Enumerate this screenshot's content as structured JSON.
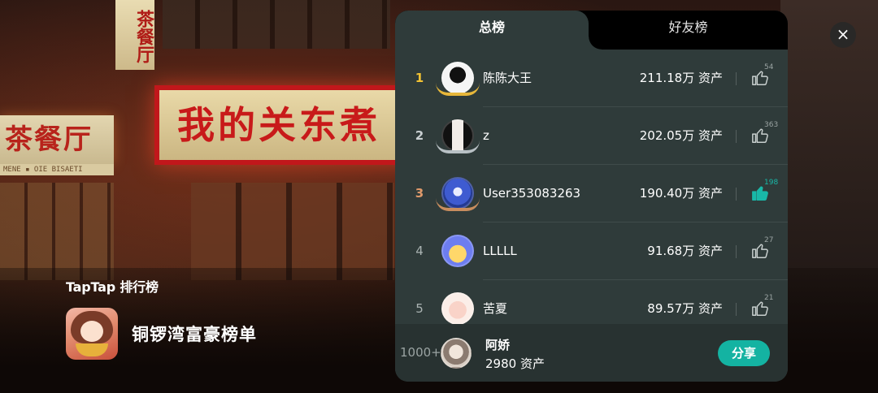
{
  "tabs": [
    {
      "label": "总榜",
      "active": true
    },
    {
      "label": "好友榜",
      "active": false
    }
  ],
  "leaderboard": [
    {
      "rank": "1",
      "name": "陈陈大王",
      "assets": "211.18万 资产",
      "likes": "54",
      "liked": false,
      "medal": "gold"
    },
    {
      "rank": "2",
      "name": "z",
      "assets": "202.05万 资产",
      "likes": "363",
      "liked": false,
      "medal": "silver"
    },
    {
      "rank": "3",
      "name": "User353083263",
      "assets": "190.40万 资产",
      "likes": "198",
      "liked": true,
      "medal": "bronze"
    },
    {
      "rank": "4",
      "name": "LLLLL",
      "assets": "91.68万 资产",
      "likes": "27",
      "liked": false,
      "medal": ""
    },
    {
      "rank": "5",
      "name": "苦夏",
      "assets": "89.57万 资产",
      "likes": "21",
      "liked": false,
      "medal": ""
    }
  ],
  "me": {
    "rank": "1000+",
    "name": "阿娇",
    "assets": "2980 资产",
    "share_label": "分享"
  },
  "left": {
    "brand": "TapTap 排行榜",
    "game_title": "铜锣湾富豪榜单"
  },
  "background_signs": {
    "big": "我的关东煮",
    "left": "茶餐厅",
    "left_sub": "MENE ▪ OIE   BISAETI",
    "vertical": "茶餐厅"
  },
  "close_icon": "×",
  "colors": {
    "accent": "#14b3a2",
    "gold": "#f2c233",
    "panel": "#2f3b3a"
  }
}
